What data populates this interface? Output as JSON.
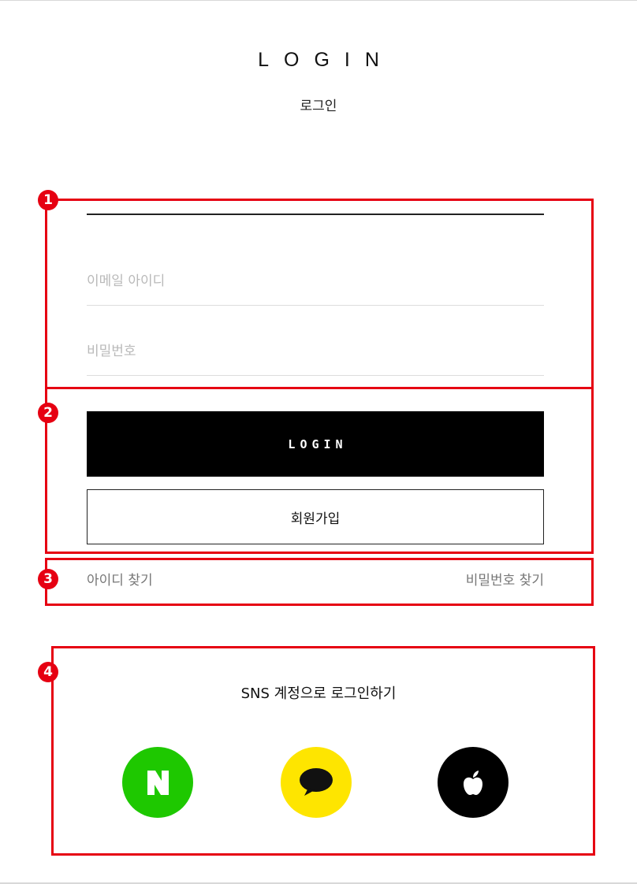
{
  "header": {
    "title": "LOGIN",
    "subtitle": "로그인"
  },
  "annotations": [
    "1",
    "2",
    "3",
    "4"
  ],
  "form": {
    "email_placeholder": "이메일 아이디",
    "password_placeholder": "비밀번호",
    "login_label": "LOGIN",
    "join_label": "회원가입"
  },
  "links": {
    "find_id": "아이디 찾기",
    "find_password": "비밀번호 찾기"
  },
  "sns": {
    "title": "SNS 계정으로 로그인하기",
    "providers": [
      {
        "name": "naver-icon",
        "color": "#1ec800",
        "glyph": "N"
      },
      {
        "name": "kakao-icon",
        "color": "#fee500"
      },
      {
        "name": "apple-icon",
        "color": "#000000"
      }
    ]
  },
  "colors": {
    "highlight": "#e60012",
    "primary_button": "#000000"
  }
}
